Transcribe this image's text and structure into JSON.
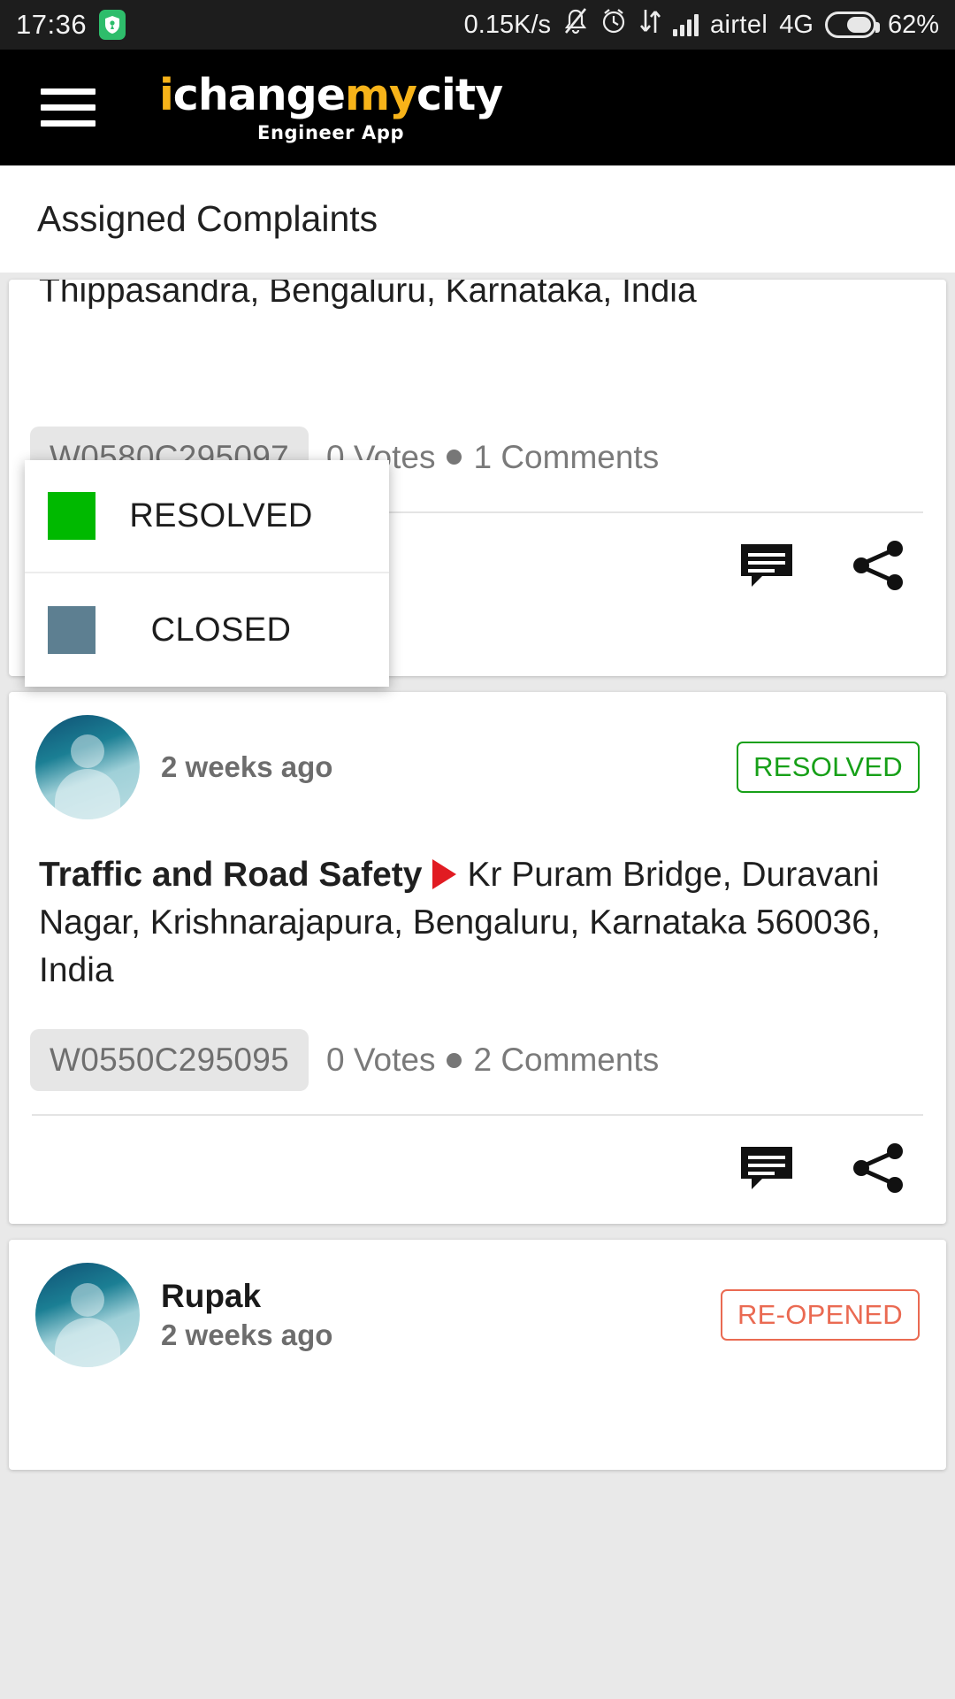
{
  "status_bar": {
    "time": "17:36",
    "shield_icon": "shield-icon",
    "network_speed": "0.15K/s",
    "silent_icon": "bell-muted-icon",
    "alarm_icon": "alarm-clock-icon",
    "data_transfer_icon": "data-transfer-icon",
    "signal_icon": "signal-bars-icon",
    "carrier": "airtel",
    "network_type": "4G",
    "battery_icon": "battery-icon",
    "battery_percent": "62%"
  },
  "app_bar": {
    "menu_icon": "hamburger-menu-icon",
    "brand_part1": "i",
    "brand_part2": "change",
    "brand_part3": "my",
    "brand_part4": "city",
    "subtitle": "Engineer App",
    "brand_white": "#ffffff",
    "brand_yellow": "#f7b319"
  },
  "page": {
    "title": "Assigned Complaints"
  },
  "dropdown": {
    "items": [
      {
        "label": "RESOLVED",
        "color": "#00b900",
        "swatch_name": "status-swatch-resolved"
      },
      {
        "label": "CLOSED",
        "color": "#5d7f91",
        "swatch_name": "status-swatch-closed"
      }
    ]
  },
  "complaints": [
    {
      "address_visible": "Thippasandra, Bengaluru, Karnataka, India",
      "id": "W0580C295097",
      "votes": "0 Votes",
      "comments": "1 Comments",
      "comment_icon": "comment-icon",
      "share_icon": "share-icon"
    },
    {
      "user": "",
      "time": "2 weeks ago",
      "status": "RESOLVED",
      "status_color": "#17a018",
      "category": "Traffic and Road Safety",
      "address": "Kr Puram Bridge, Duravani Nagar, Krishnarajapura, Bengaluru, Karnataka 560036, India",
      "id": "W0550C295095",
      "votes": "0 Votes",
      "comments": "2 Comments",
      "comment_icon": "comment-icon",
      "share_icon": "share-icon"
    },
    {
      "user": "Rupak",
      "time": "2 weeks ago",
      "status": "RE-OPENED",
      "status_color": "#ea6a52"
    }
  ]
}
